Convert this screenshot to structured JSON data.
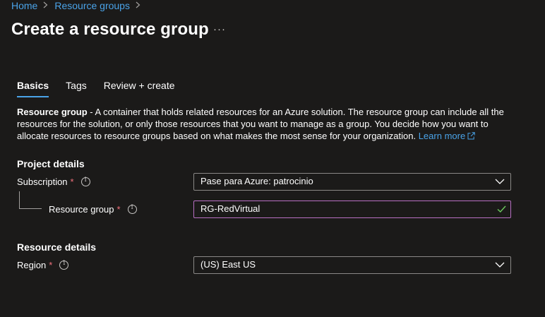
{
  "breadcrumb": {
    "items": [
      "Home",
      "Resource groups"
    ]
  },
  "header": {
    "title": "Create a resource group",
    "more_label": "···"
  },
  "tabs": [
    {
      "label": "Basics",
      "active": true
    },
    {
      "label": "Tags",
      "active": false
    },
    {
      "label": "Review + create",
      "active": false
    }
  ],
  "description": {
    "term": "Resource group",
    "text": " - A container that holds related resources for an Azure solution. The resource group can include all the resources for the solution, or only those resources that you want to manage as a group. You decide how you want to allocate resources to resource groups based on what makes the most sense for your organization. ",
    "link": "Learn more"
  },
  "project_details": {
    "heading": "Project details",
    "subscription": {
      "label": "Subscription",
      "required": "*",
      "value": "Pase para Azure: patrocinio"
    },
    "resource_group": {
      "label": "Resource group",
      "required": "*",
      "value": "RG-RedVirtual"
    }
  },
  "resource_details": {
    "heading": "Resource details",
    "region": {
      "label": "Region",
      "required": "*",
      "value": "(US) East US"
    }
  },
  "colors": {
    "background": "#1b1a19",
    "link": "#4aa3e8",
    "required": "#f1707b",
    "valid_border": "#b86fc3",
    "valid_check": "#6ccb5f"
  },
  "icons": [
    "chevron-right-icon",
    "more-icon",
    "info-icon",
    "external-link-icon",
    "chevron-down-icon",
    "checkmark-icon"
  ]
}
